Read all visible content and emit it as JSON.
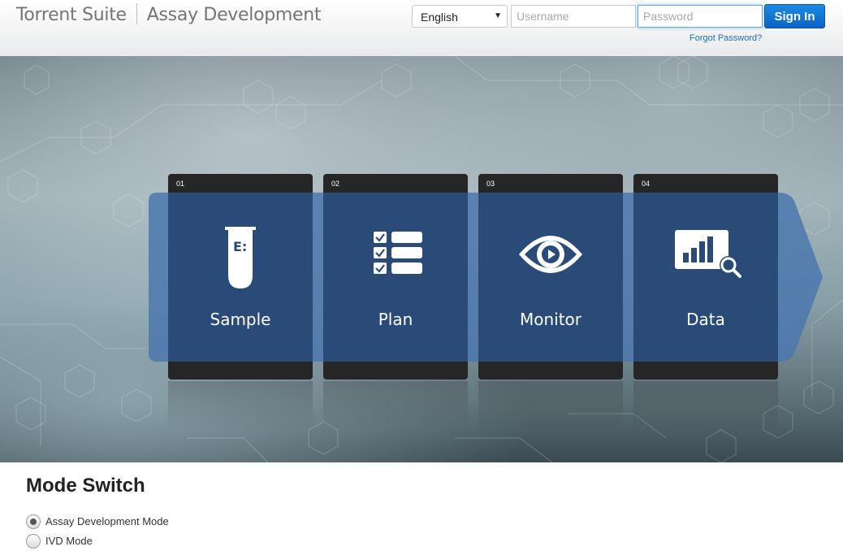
{
  "header": {
    "app_name": "Torrent Suite",
    "product_name": "Assay Development",
    "language": {
      "selected": "English"
    },
    "username": {
      "value": "",
      "placeholder": "Username"
    },
    "password": {
      "value": "",
      "placeholder": "Password"
    },
    "signin_label": "Sign In",
    "forgot_label": "Forgot Password?"
  },
  "workflow": {
    "steps": [
      {
        "number": "01",
        "label": "Sample",
        "icon": "test-tube-icon"
      },
      {
        "number": "02",
        "label": "Plan",
        "icon": "checklist-icon"
      },
      {
        "number": "03",
        "label": "Monitor",
        "icon": "eye-icon"
      },
      {
        "number": "04",
        "label": "Data",
        "icon": "chart-magnifier-icon"
      }
    ]
  },
  "mode_switch": {
    "title": "Mode Switch",
    "options": [
      {
        "label": "Assay Development Mode",
        "selected": true
      },
      {
        "label": "IVD Mode",
        "selected": false
      }
    ]
  },
  "colors": {
    "card_blue": "#2a4b78",
    "band_blue": "#4b78ae",
    "signin_blue": "#0b63c4",
    "link_blue": "#1a6fb8"
  }
}
